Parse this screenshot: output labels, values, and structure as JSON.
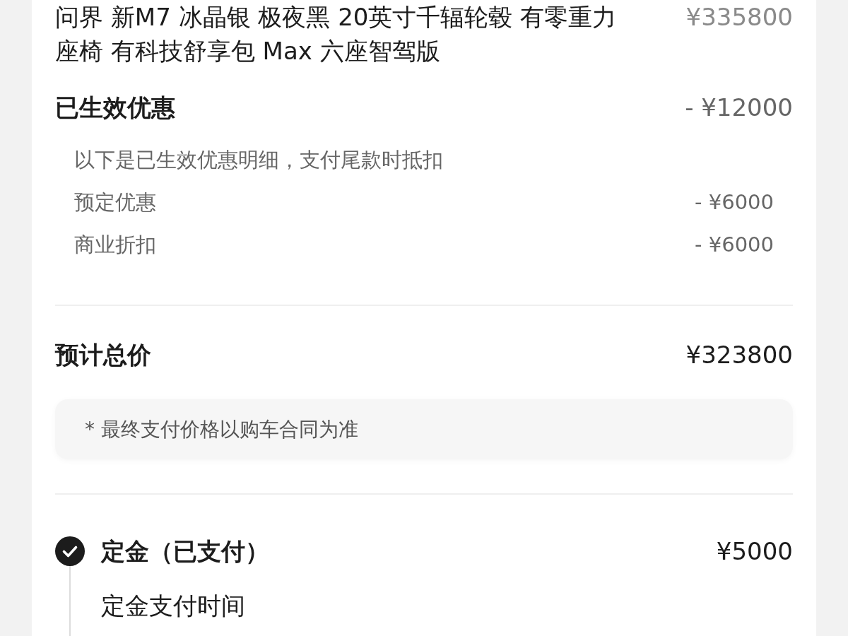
{
  "vehicle": {
    "description": "问界 新M7 冰晶银 极夜黑 20英寸千辐轮毂 有零重力座椅 有科技舒享包 Max 六座智驾版",
    "price": "¥335800"
  },
  "discounts": {
    "title": "已生效优惠",
    "total": "- ¥12000",
    "note": "以下是已生效优惠明细，支付尾款时抵扣",
    "items": [
      {
        "label": "预定优惠",
        "amount": "- ¥6000"
      },
      {
        "label": "商业折扣",
        "amount": "- ¥6000"
      }
    ]
  },
  "estimated_total": {
    "label": "预计总价",
    "amount": "¥323800"
  },
  "disclaimer": "* 最终支付价格以购车合同为准",
  "payments": [
    {
      "title": "定金（已支付）",
      "amount": "¥5000",
      "paid": true,
      "detail_label": "定金支付时间"
    }
  ]
}
